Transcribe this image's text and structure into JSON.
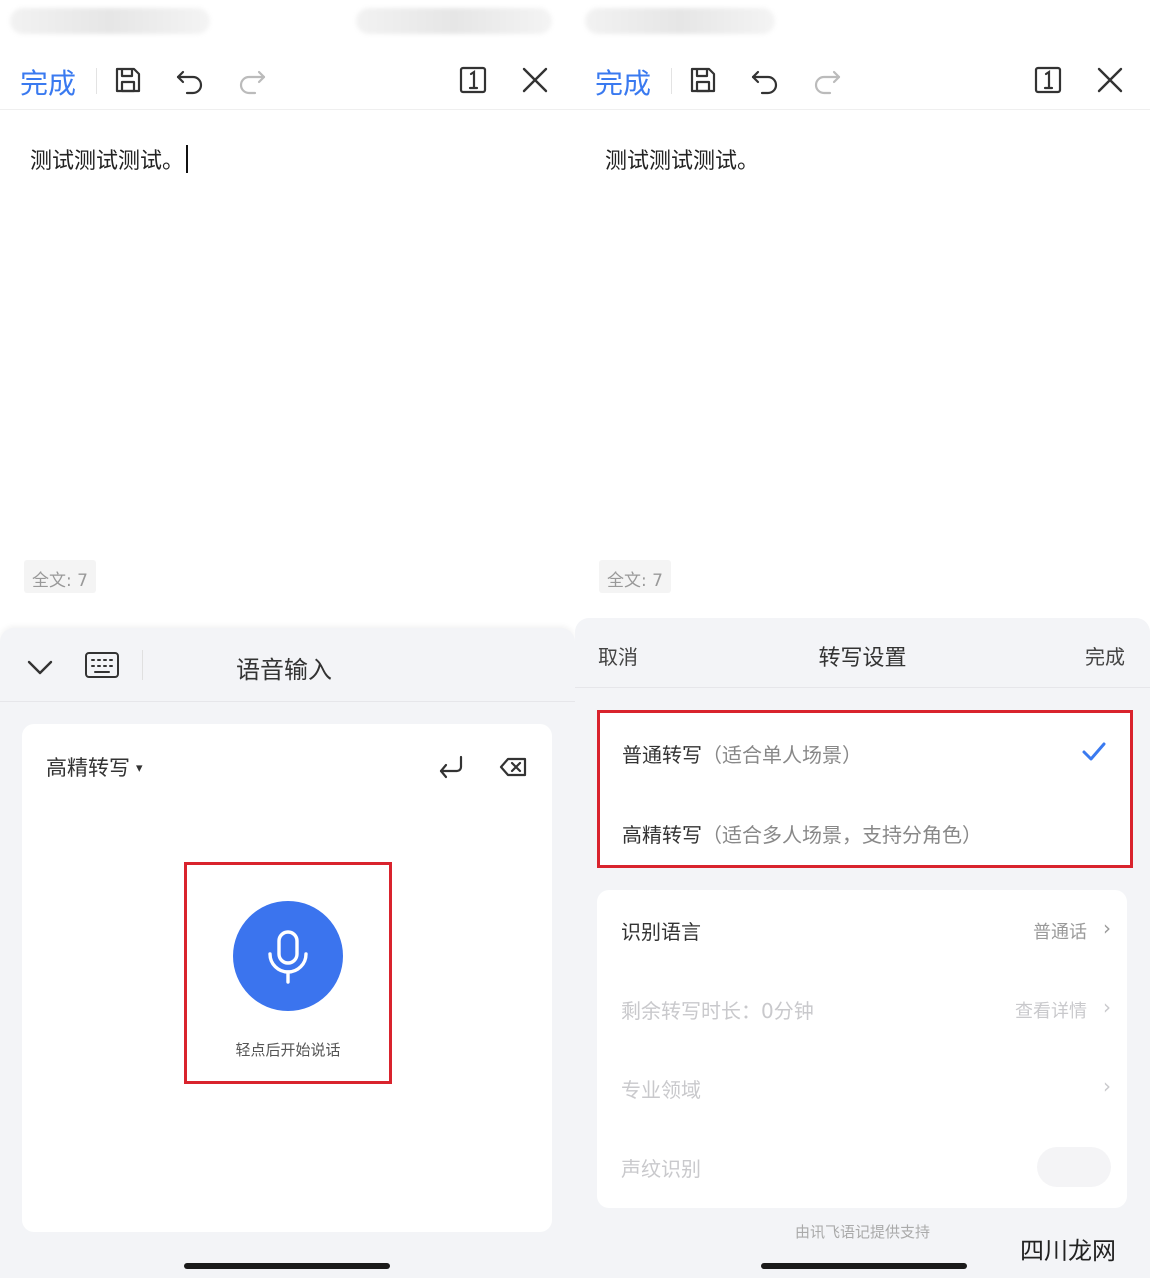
{
  "left": {
    "toolbar": {
      "done_label": "完成",
      "icons": [
        "save-icon",
        "undo-icon",
        "redo-icon",
        "page-count-icon",
        "close-icon"
      ]
    },
    "document": {
      "text": "测试测试测试。"
    },
    "counter": "全文: 7",
    "voice_panel": {
      "title": "语音输入",
      "mode_label": "高精转写",
      "mode_arrow": "▾",
      "mic_hint": "轻点后开始说话",
      "icons": [
        "chevron-down-icon",
        "keyboard-icon",
        "enter-icon",
        "backspace-icon",
        "microphone-icon"
      ]
    }
  },
  "right": {
    "toolbar": {
      "done_label": "完成"
    },
    "document": {
      "text": "测试测试测试。"
    },
    "counter": "全文: 7",
    "settings": {
      "cancel_label": "取消",
      "title": "转写设置",
      "done_label": "完成",
      "options": [
        {
          "label": "普通转写",
          "note": "（适合单人场景）",
          "selected": true
        },
        {
          "label": "高精转写",
          "note": "（适合多人场景，支持分角色）",
          "selected": false
        }
      ],
      "rows": [
        {
          "label": "识别语言",
          "value": "普通话",
          "chevron": "›",
          "enabled": true
        },
        {
          "label": "剩余转写时长：0分钟",
          "value": "查看详情",
          "chevron": "›",
          "enabled": false
        },
        {
          "label": "专业领域",
          "value": "",
          "chevron": "›",
          "enabled": false
        },
        {
          "label": "声纹识别",
          "value": "",
          "chevron": "",
          "enabled": false
        }
      ],
      "footer": "由讯飞语记提供支持"
    }
  },
  "colors": {
    "accent": "#3a7af0",
    "mic": "#3b74ee",
    "highlight": "#d9232d"
  },
  "watermark": "四川龙网"
}
